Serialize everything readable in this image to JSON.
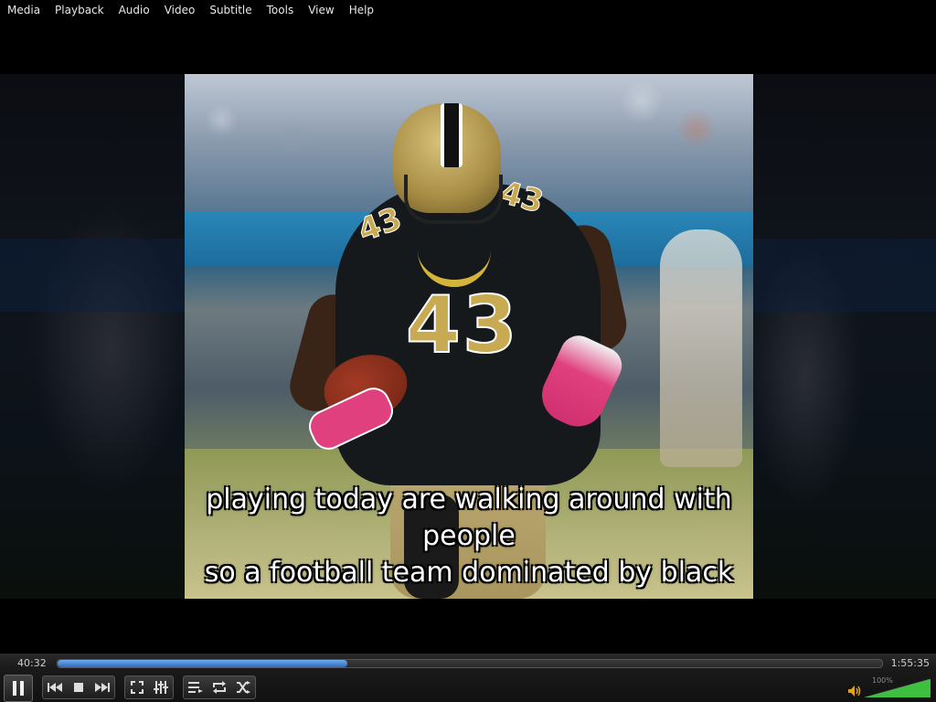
{
  "menu": {
    "items": [
      "Media",
      "Playback",
      "Audio",
      "Video",
      "Subtitle",
      "Tools",
      "View",
      "Help"
    ]
  },
  "video": {
    "subtitle_lines": [
      "playing today are walking around with",
      "people",
      "so a football team dominated by black"
    ],
    "jersey_number": "43"
  },
  "playback": {
    "elapsed": "40:32",
    "total": "1:55:35",
    "progress": 0.351,
    "state": "playing"
  },
  "controls": {
    "play_pause_icon": "pause-icon",
    "transport": [
      "previous-icon",
      "stop-icon",
      "next-icon"
    ],
    "view": [
      "fullscreen-icon",
      "extended-settings-icon"
    ],
    "playlist": [
      "playlist-icon",
      "loop-icon",
      "shuffle-icon"
    ]
  },
  "volume": {
    "label": "100%",
    "level": 1.0,
    "color": "#3fbf3f"
  },
  "colors": {
    "seek_fill": "#2e6bc4",
    "background": "#000000"
  }
}
